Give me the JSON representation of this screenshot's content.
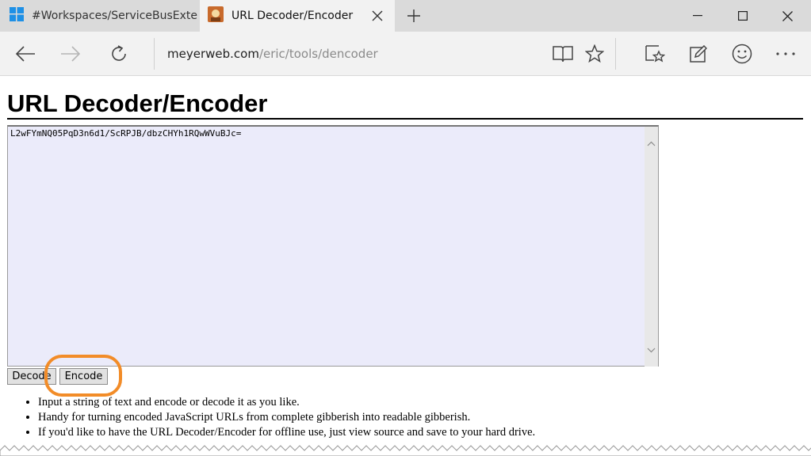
{
  "tabs": [
    {
      "label": "#Workspaces/ServiceBusExtens",
      "icon": "windows-logo-icon"
    },
    {
      "label": "URL Decoder/Encoder",
      "icon": "site-favicon-icon",
      "active": true
    }
  ],
  "address": {
    "host": "meyerweb.com",
    "path": "/eric/tools/dencoder"
  },
  "page": {
    "title": "URL Decoder/Encoder",
    "textarea_value": "L2wFYmNQ05PqD3n6d1/ScRPJB/dbzCHYh1RQwWVuBJc=",
    "decode_label": "Decode",
    "encode_label": "Encode",
    "notes": [
      "Input a string of text and encode or decode it as you like.",
      "Handy for turning encoded JavaScript URLs from complete gibberish into readable gibberish.",
      "If you'd like to have the URL Decoder/Encoder for offline use, just view source and save to your hard drive."
    ]
  },
  "colors": {
    "highlight": "#f28c28",
    "textarea_bg": "#ebebfa",
    "tabbar": "#dadada",
    "navbar": "#f2f2f2"
  }
}
